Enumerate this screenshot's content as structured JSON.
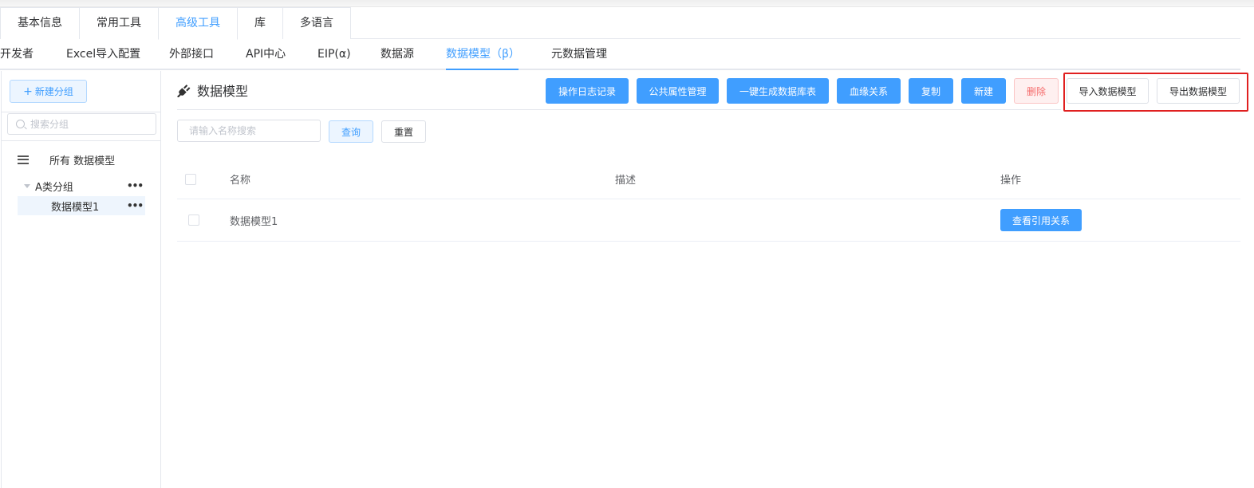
{
  "tabs_primary": [
    {
      "label": "基本信息",
      "active": false
    },
    {
      "label": "常用工具",
      "active": false
    },
    {
      "label": "高级工具",
      "active": true
    },
    {
      "label": "库",
      "active": false
    },
    {
      "label": "多语言",
      "active": false
    }
  ],
  "tabs_secondary": [
    {
      "label": "开发者",
      "active": false
    },
    {
      "label": "Excel导入配置",
      "active": false
    },
    {
      "label": "外部接口",
      "active": false
    },
    {
      "label": "API中心",
      "active": false
    },
    {
      "label": "EIP(α)",
      "active": false
    },
    {
      "label": "数据源",
      "active": false
    },
    {
      "label": "数据模型（β）",
      "active": true
    },
    {
      "label": "元数据管理",
      "active": false
    }
  ],
  "sidebar": {
    "new_group_label": "新建分组",
    "search_placeholder": "搜索分组",
    "all_label": "所有 数据模型",
    "groups": [
      {
        "label": "A类分组",
        "more": "•••",
        "children": [
          {
            "label": "数据模型1",
            "more": "•••",
            "selected": true
          }
        ]
      }
    ]
  },
  "main": {
    "title": "数据模型",
    "toolbar": {
      "log": "操作日志记录",
      "common_attr": "公共属性管理",
      "gen_table": "一键生成数据库表",
      "lineage": "血缘关系",
      "copy": "复制",
      "create": "新建",
      "delete": "删除",
      "import": "导入数据模型",
      "export": "导出数据模型"
    },
    "search_placeholder": "请输入名称搜索",
    "query_label": "查询",
    "reset_label": "重置",
    "table": {
      "columns": [
        "名称",
        "描述",
        "操作"
      ],
      "rows": [
        {
          "name": "数据模型1",
          "description": "",
          "action": "查看引用关系"
        }
      ]
    }
  },
  "colors": {
    "primary": "#409eff",
    "danger": "#f56c6c",
    "highlight": "#e02020"
  }
}
